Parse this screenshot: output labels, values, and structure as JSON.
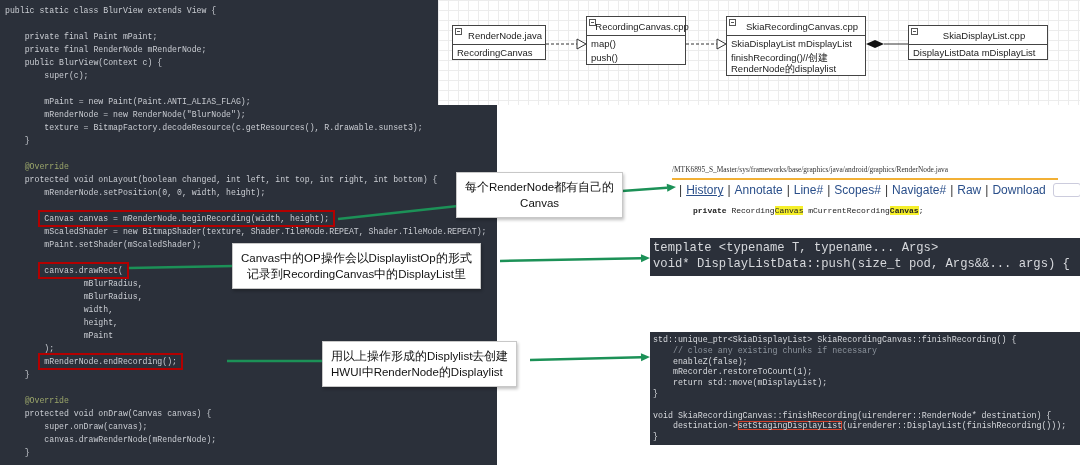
{
  "editor": {
    "lines": [
      {
        "kind": "code",
        "text": "public static class BlurView extends View {",
        "highlighted": false
      },
      {
        "kind": "blank"
      },
      {
        "kind": "code",
        "text": "    private final Paint mPaint;",
        "highlighted": false
      },
      {
        "kind": "code",
        "text": "    private final RenderNode mRenderNode;",
        "highlighted": false
      },
      {
        "kind": "code",
        "text": "    public BlurView(Context c) {",
        "highlighted": false
      },
      {
        "kind": "code",
        "text": "        super(c);",
        "highlighted": false
      },
      {
        "kind": "blank"
      },
      {
        "kind": "code",
        "text": "        mPaint = new Paint(Paint.ANTI_ALIAS_FLAG);",
        "highlighted": false
      },
      {
        "kind": "code",
        "text": "        mRenderNode = new RenderNode(\"BlurNode\");",
        "highlighted": false
      },
      {
        "kind": "code",
        "text": "        texture = BitmapFactory.decodeResource(c.getResources(), R.drawable.sunset3);",
        "highlighted": false
      },
      {
        "kind": "code",
        "text": "    }",
        "highlighted": false
      },
      {
        "kind": "blank"
      },
      {
        "kind": "annotation",
        "text": "    @Override",
        "highlighted": false
      },
      {
        "kind": "code",
        "text": "    protected void onLayout(boolean changed, int left, int top, int right, int bottom) {",
        "highlighted": false
      },
      {
        "kind": "code",
        "text": "        mRenderNode.setPosition(0, 0, width, height);",
        "highlighted": false
      },
      {
        "kind": "blank"
      },
      {
        "kind": "code",
        "text": "        Canvas canvas = mRenderNode.beginRecording(width, height);",
        "highlighted": true
      },
      {
        "kind": "code",
        "text": "        mScaledShader = new BitmapShader(texture, Shader.TileMode.REPEAT, Shader.TileMode.REPEAT);",
        "highlighted": false
      },
      {
        "kind": "code",
        "text": "        mPaint.setShader(mScaledShader);",
        "highlighted": false
      },
      {
        "kind": "blank"
      },
      {
        "kind": "code",
        "text": "        canvas.drawRect(",
        "highlighted": true
      },
      {
        "kind": "code",
        "text": "                mBlurRadius,",
        "highlighted": false
      },
      {
        "kind": "code",
        "text": "                mBlurRadius,",
        "highlighted": false
      },
      {
        "kind": "code",
        "text": "                width,",
        "highlighted": false
      },
      {
        "kind": "code",
        "text": "                height,",
        "highlighted": false
      },
      {
        "kind": "code",
        "text": "                mPaint",
        "highlighted": false
      },
      {
        "kind": "code",
        "text": "        );",
        "highlighted": false
      },
      {
        "kind": "code",
        "text": "        mRenderNode.endRecording();",
        "highlighted": true
      },
      {
        "kind": "code",
        "text": "    }",
        "highlighted": false
      },
      {
        "kind": "blank"
      },
      {
        "kind": "annotation",
        "text": "    @Override",
        "highlighted": false
      },
      {
        "kind": "code",
        "text": "    protected void onDraw(Canvas canvas) {",
        "highlighted": false
      },
      {
        "kind": "code",
        "text": "        super.onDraw(canvas);",
        "highlighted": false
      },
      {
        "kind": "code",
        "text": "        canvas.drawRenderNode(mRenderNode);",
        "highlighted": false
      },
      {
        "kind": "code",
        "text": "    }",
        "highlighted": false
      }
    ]
  },
  "uml": {
    "classes": [
      {
        "title": "RenderNode.java",
        "members": [
          "RecordingCanvas"
        ]
      },
      {
        "title": "RecordingCanvas.cpp",
        "members": [
          "map()",
          "push()"
        ]
      },
      {
        "title": "SkiaRecordingCanvas.cpp",
        "members": [
          "SkiaDisplayList mDisplayList",
          "finishRecording()//创建\nRenderNode的displaylist"
        ]
      },
      {
        "title": "SkiaDisplayList.cpp",
        "members": [
          "DisplayListData mDisplayList"
        ]
      }
    ],
    "relations": [
      {
        "kind": "realization"
      },
      {
        "kind": "realization"
      },
      {
        "kind": "composition"
      }
    ]
  },
  "source_browser": {
    "path": "/MTK6895_S_Master/sys/frameworks/base/graphics/java/android/graphics/RenderNode.java",
    "separator": "|",
    "links": [
      {
        "label": "History",
        "selected": true
      },
      {
        "label": "Annotate",
        "selected": false
      },
      {
        "label": "Line#",
        "selected": false
      },
      {
        "label": "Scopes#",
        "selected": false
      },
      {
        "label": "Navigate#",
        "selected": false
      },
      {
        "label": "Raw",
        "selected": false
      },
      {
        "label": "Download",
        "selected": false
      }
    ],
    "code": [
      {
        "text": "private",
        "bold": true,
        "highlighted": false
      },
      {
        "text": " Recording",
        "bold": false,
        "highlighted": false
      },
      {
        "text": "Canvas",
        "bold": false,
        "highlighted": true
      },
      {
        "text": " mCurrentRecording",
        "bold": false,
        "highlighted": false
      },
      {
        "text": "Canvas",
        "bold": true,
        "highlighted": true
      },
      {
        "text": ";",
        "bold": false,
        "highlighted": false
      }
    ]
  },
  "push_snippet": {
    "lines": [
      "template <typename T, typename... Args>",
      "void* DisplayListData::push(size_t pod, Args&&... args) {"
    ]
  },
  "finish_snippet": {
    "lines": [
      {
        "kind": "code",
        "segments": [
          {
            "text": "std::unique_ptr<SkiaDisplayList> SkiaRecordingCanvas::finishRecording() {",
            "boxed": false
          }
        ]
      },
      {
        "kind": "comment",
        "segments": [
          {
            "text": "    // close any existing chunks if necessary",
            "boxed": false
          }
        ]
      },
      {
        "kind": "code",
        "segments": [
          {
            "text": "    enableZ(false);",
            "boxed": false
          }
        ]
      },
      {
        "kind": "code",
        "segments": [
          {
            "text": "    mRecorder.restoreToCount(1);",
            "boxed": false
          }
        ]
      },
      {
        "kind": "code",
        "segments": [
          {
            "text": "    return std::move(mDisplayList);",
            "boxed": false
          }
        ]
      },
      {
        "kind": "code",
        "segments": [
          {
            "text": "}",
            "boxed": false
          }
        ]
      },
      {
        "kind": "blank"
      },
      {
        "kind": "code",
        "segments": [
          {
            "text": "void SkiaRecordingCanvas::finishRecording(uirenderer::RenderNode* destination) {",
            "boxed": false
          }
        ]
      },
      {
        "kind": "code",
        "segments": [
          {
            "text": "    destination->",
            "boxed": false
          },
          {
            "text": "setStagingDisplayList",
            "boxed": true
          },
          {
            "text": "(uirenderer::DisplayList(finishRecording()));",
            "boxed": false
          }
        ]
      },
      {
        "kind": "code",
        "segments": [
          {
            "text": "}",
            "boxed": false
          }
        ]
      }
    ]
  },
  "callouts": [
    {
      "lines": [
        "每个RenderNode都有自己的",
        "Canvas"
      ]
    },
    {
      "lines": [
        "Canvas中的OP操作会以DisplaylistOp的形式",
        "记录到RecordingCanvas中的DisplayList里"
      ]
    },
    {
      "lines": [
        "用以上操作形成的Displylist去创建",
        "HWUI中RenderNode的Displaylist"
      ]
    }
  ]
}
